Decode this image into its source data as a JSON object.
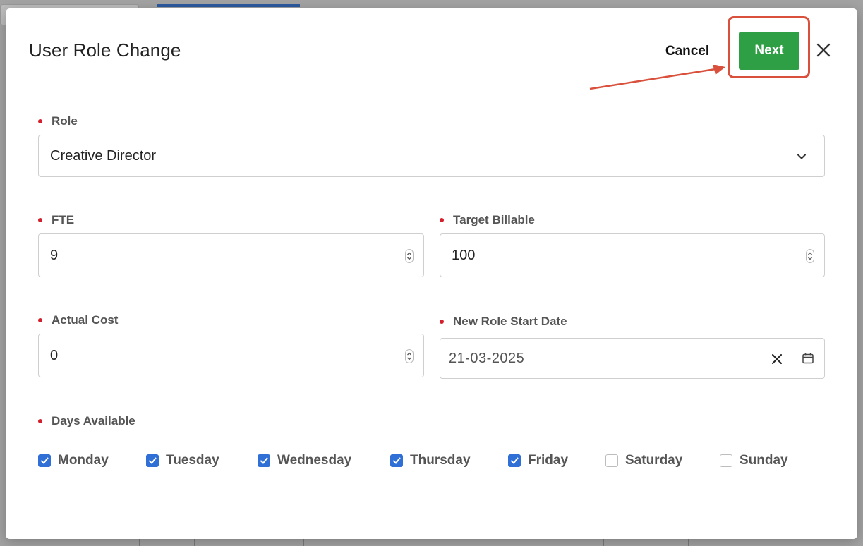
{
  "modal": {
    "title": "User Role Change",
    "cancel_label": "Cancel",
    "next_label": "Next"
  },
  "fields": {
    "role": {
      "label": "Role",
      "value": "Creative Director"
    },
    "fte": {
      "label": "FTE",
      "value": "9"
    },
    "target_billable": {
      "label": "Target Billable",
      "value": "100"
    },
    "actual_cost": {
      "label": "Actual Cost",
      "value": "0"
    },
    "new_role_start_date": {
      "label": "New Role Start Date",
      "value": "21-03-2025"
    }
  },
  "days_available": {
    "label": "Days Available",
    "days": [
      {
        "label": "Monday",
        "checked": true
      },
      {
        "label": "Tuesday",
        "checked": true
      },
      {
        "label": "Wednesday",
        "checked": true
      },
      {
        "label": "Thursday",
        "checked": true
      },
      {
        "label": "Friday",
        "checked": true
      },
      {
        "label": "Saturday",
        "checked": false
      },
      {
        "label": "Sunday",
        "checked": false
      }
    ]
  },
  "colors": {
    "accent_green": "#2e9f45",
    "highlight_red": "#d9513d",
    "required_dot": "#d3202c",
    "checkbox_blue": "#2f6fd6"
  },
  "icons": [
    "close-icon",
    "chevron-down-icon",
    "stepper-icon",
    "clear-icon",
    "calendar-icon",
    "check-icon",
    "annotation-arrow"
  ]
}
